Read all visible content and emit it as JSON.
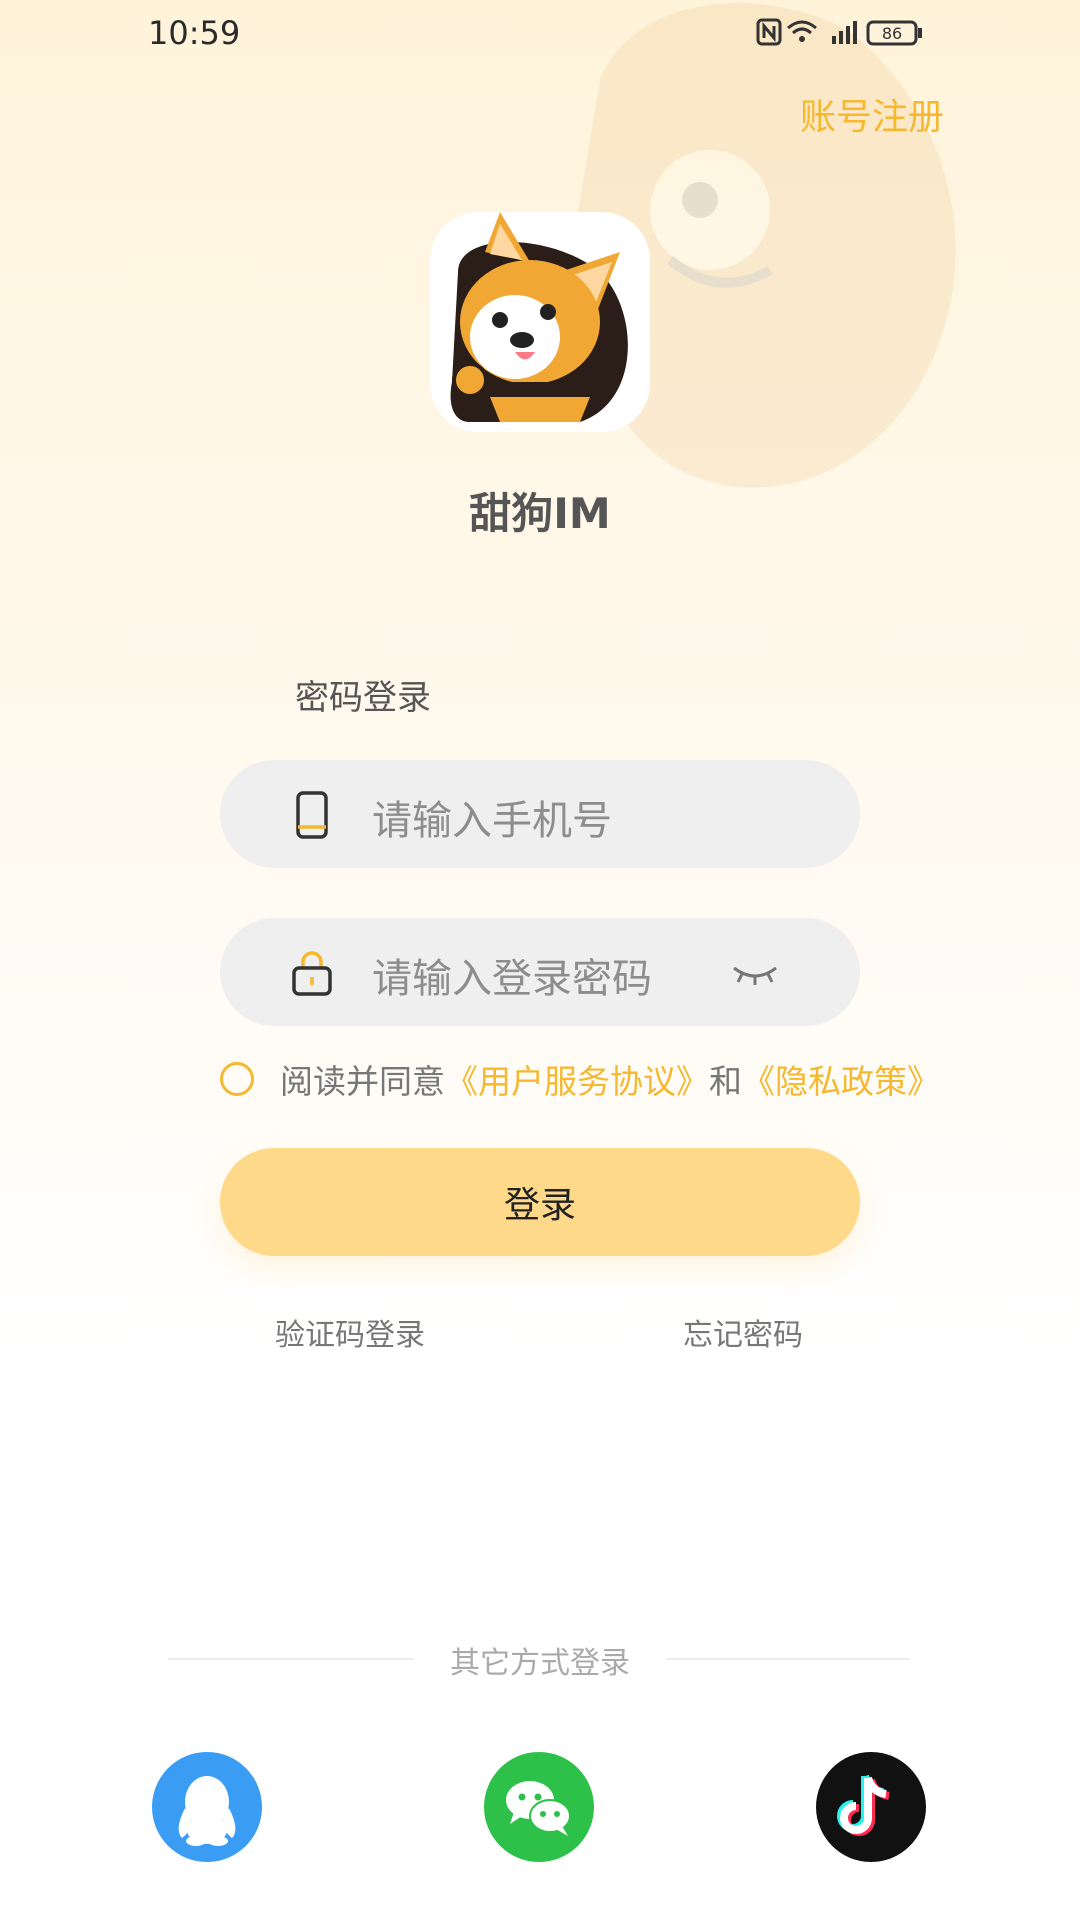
{
  "status_bar": {
    "time": "10:59",
    "battery": "86"
  },
  "header": {
    "register_label": "账号注册"
  },
  "app": {
    "name": "甜狗IM"
  },
  "login": {
    "section_title": "密码登录",
    "phone_placeholder": "请输入手机号",
    "password_placeholder": "请输入登录密码",
    "agreement": {
      "prefix": "阅读并同意",
      "service_link": "《用户服务协议》",
      "connector": "和",
      "privacy_link": "《隐私政策》"
    },
    "login_button": "登录",
    "sms_login": "验证码登录",
    "forgot_password": "忘记密码"
  },
  "other_login": {
    "title": "其它方式登录",
    "providers": [
      "qq-icon",
      "wechat-icon",
      "tiktok-icon"
    ]
  },
  "colors": {
    "accent": "#f5b82e",
    "button": "#ffd98a",
    "input_bg": "#efefef",
    "qq": "#3b9cf3",
    "wechat": "#2ec14a",
    "tiktok": "#111111"
  }
}
